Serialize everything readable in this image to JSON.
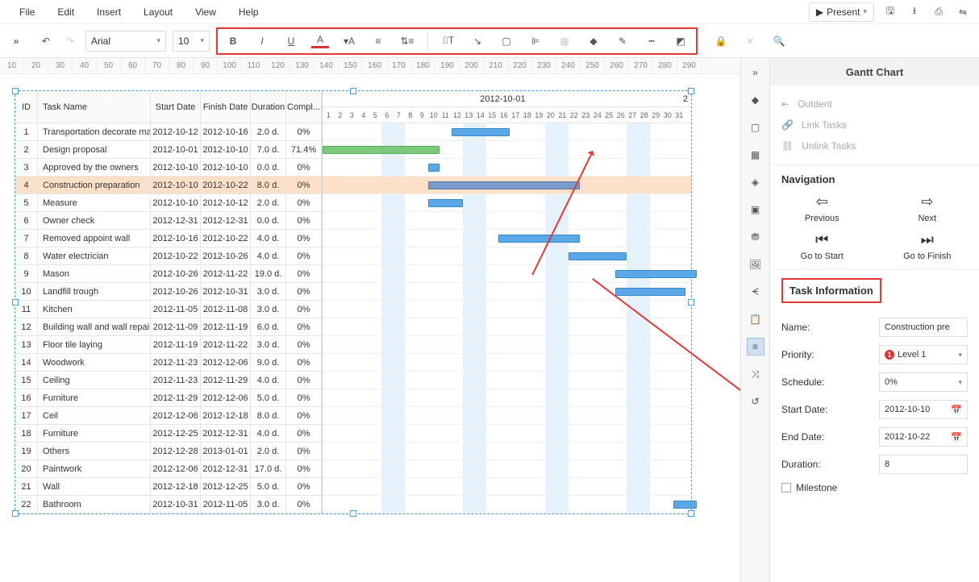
{
  "menu": {
    "items": [
      "File",
      "Edit",
      "Insert",
      "Layout",
      "View",
      "Help"
    ],
    "present": "Present"
  },
  "toolbar": {
    "font": "Arial",
    "size": "10"
  },
  "ruler": [
    10,
    20,
    30,
    40,
    50,
    60,
    70,
    80,
    90,
    100,
    110,
    120,
    130,
    140,
    150,
    160,
    170,
    180,
    190,
    200,
    210,
    220,
    230,
    240,
    250,
    260,
    270,
    280,
    290
  ],
  "gantt": {
    "headers": {
      "id": "ID",
      "name": "Task Name",
      "start": "Start Date",
      "finish": "Finish Date",
      "dur": "Duration",
      "comp": "Compl..."
    },
    "month": "2012-10-01",
    "last_day_prefix": "2",
    "days": [
      1,
      2,
      3,
      4,
      5,
      6,
      7,
      8,
      9,
      10,
      11,
      12,
      13,
      14,
      15,
      16,
      17,
      18,
      19,
      20,
      21,
      22,
      23,
      24,
      25,
      26,
      27,
      28,
      29,
      30,
      31
    ],
    "rows": [
      {
        "id": 1,
        "name": "Transportation decorate ma...",
        "start": "2012-10-12",
        "finish": "2012-10-16",
        "dur": "2.0 d.",
        "comp": "0%",
        "bar": [
          12,
          16
        ]
      },
      {
        "id": 2,
        "name": "Design proposal",
        "start": "2012-10-01",
        "finish": "2012-10-10",
        "dur": "7.0 d.",
        "comp": "71.4%",
        "bar": [
          1,
          10
        ],
        "green": true
      },
      {
        "id": 3,
        "name": "Approved by the owners",
        "start": "2012-10-10",
        "finish": "2012-10-10",
        "dur": "0.0 d.",
        "comp": "0%",
        "bar": [
          10,
          10
        ]
      },
      {
        "id": 4,
        "name": "Construction preparation",
        "start": "2012-10-10",
        "finish": "2012-10-22",
        "dur": "8.0 d.",
        "comp": "0%",
        "bar": [
          10,
          22
        ],
        "selected": true
      },
      {
        "id": 5,
        "name": "Measure",
        "start": "2012-10-10",
        "finish": "2012-10-12",
        "dur": "2.0 d.",
        "comp": "0%",
        "bar": [
          10,
          12
        ]
      },
      {
        "id": 6,
        "name": "Owner check",
        "start": "2012-12-31",
        "finish": "2012-12-31",
        "dur": "0.0 d.",
        "comp": "0%"
      },
      {
        "id": 7,
        "name": "Removed appoint wall",
        "start": "2012-10-16",
        "finish": "2012-10-22",
        "dur": "4.0 d.",
        "comp": "0%",
        "bar": [
          16,
          22
        ]
      },
      {
        "id": 8,
        "name": "Water electrician",
        "start": "2012-10-22",
        "finish": "2012-10-26",
        "dur": "4.0 d.",
        "comp": "0%",
        "bar": [
          22,
          26
        ]
      },
      {
        "id": 9,
        "name": "Mason",
        "start": "2012-10-26",
        "finish": "2012-11-22",
        "dur": "19.0 d.",
        "comp": "0%",
        "bar": [
          26,
          32
        ]
      },
      {
        "id": 10,
        "name": "Landfill trough",
        "start": "2012-10-26",
        "finish": "2012-10-31",
        "dur": "3.0 d.",
        "comp": "0%",
        "bar": [
          26,
          31
        ]
      },
      {
        "id": 11,
        "name": "Kitchen",
        "start": "2012-11-05",
        "finish": "2012-11-08",
        "dur": "3.0 d.",
        "comp": "0%"
      },
      {
        "id": 12,
        "name": "Building wall and wall repair",
        "start": "2012-11-09",
        "finish": "2012-11-19",
        "dur": "6.0 d.",
        "comp": "0%"
      },
      {
        "id": 13,
        "name": "Floor tile laying",
        "start": "2012-11-19",
        "finish": "2012-11-22",
        "dur": "3.0 d.",
        "comp": "0%"
      },
      {
        "id": 14,
        "name": "Woodwork",
        "start": "2012-11-23",
        "finish": "2012-12-06",
        "dur": "9.0 d.",
        "comp": "0%"
      },
      {
        "id": 15,
        "name": "Ceiling",
        "start": "2012-11-23",
        "finish": "2012-11-29",
        "dur": "4.0 d.",
        "comp": "0%"
      },
      {
        "id": 16,
        "name": "Furniture",
        "start": "2012-11-29",
        "finish": "2012-12-06",
        "dur": "5.0 d.",
        "comp": "0%"
      },
      {
        "id": 17,
        "name": "Ceil",
        "start": "2012-12-06",
        "finish": "2012-12-18",
        "dur": "8.0 d.",
        "comp": "0%"
      },
      {
        "id": 18,
        "name": "Furniture",
        "start": "2012-12-25",
        "finish": "2012-12-31",
        "dur": "4.0 d.",
        "comp": "0%"
      },
      {
        "id": 19,
        "name": "Others",
        "start": "2012-12-28",
        "finish": "2013-01-01",
        "dur": "2.0 d.",
        "comp": "0%"
      },
      {
        "id": 20,
        "name": "Paintwork",
        "start": "2012-12-06",
        "finish": "2012-12-31",
        "dur": "17.0 d.",
        "comp": "0%"
      },
      {
        "id": 21,
        "name": "Wall",
        "start": "2012-12-18",
        "finish": "2012-12-25",
        "dur": "5.0 d.",
        "comp": "0%"
      },
      {
        "id": 22,
        "name": "Bathroom",
        "start": "2012-10-31",
        "finish": "2012-11-05",
        "dur": "3.0 d.",
        "comp": "0%",
        "bar": [
          31,
          32
        ]
      }
    ]
  },
  "panel": {
    "title": "Gantt Chart",
    "actions": {
      "outdent": "Outdent",
      "link": "Link Tasks",
      "unlink": "Unlink Tasks"
    },
    "nav": {
      "heading": "Navigation",
      "prev": "Previous",
      "next": "Next",
      "gostart": "Go to Start",
      "gofinish": "Go to Finish"
    },
    "ti": {
      "heading": "Task Information",
      "name_label": "Name:",
      "name_val": "Construction pre",
      "priority_label": "Priority:",
      "priority_val": "Level 1",
      "schedule_label": "Schedule:",
      "schedule_val": "0%",
      "start_label": "Start Date:",
      "start_val": "2012-10-10",
      "end_label": "End Date:",
      "end_val": "2012-10-22",
      "dur_label": "Duration:",
      "dur_val": "8",
      "milestone": "Milestone"
    }
  }
}
